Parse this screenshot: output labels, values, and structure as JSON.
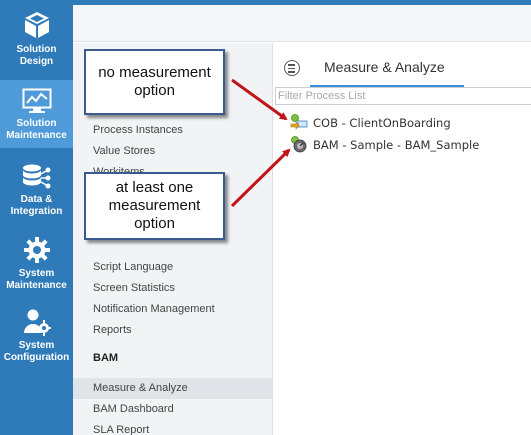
{
  "nav": {
    "items": [
      {
        "label": "Solution\nDesign",
        "icon": "cube-icon"
      },
      {
        "label": "Solution\nMaintenance",
        "icon": "monitor-chart-icon"
      },
      {
        "label": "Data &\nIntegration",
        "icon": "database-icon"
      },
      {
        "label": "System\nMaintenance",
        "icon": "gear-icon"
      },
      {
        "label": "System\nConfiguration",
        "icon": "user-gear-icon"
      }
    ],
    "active_index": 1
  },
  "menu": {
    "items_top": [
      "Process Instances",
      "Value Stores",
      "Workitems"
    ],
    "items_mid": [
      "Script Language",
      "Screen Statistics",
      "Notification Management",
      "Reports"
    ],
    "bam_heading": "BAM",
    "items_bam": [
      "Measure & Analyze",
      "BAM Dashboard",
      "SLA Report"
    ],
    "selected": "Measure & Analyze"
  },
  "main": {
    "tab_label": "Measure & Analyze",
    "filter_placeholder": "Filter Process List",
    "processes": [
      {
        "label": "COB - ClientOnBoarding",
        "icon": "process-flow-icon"
      },
      {
        "label": "BAM - Sample - BAM_Sample",
        "icon": "process-measure-icon"
      }
    ]
  },
  "callouts": {
    "first": "no measurement\noption",
    "second": "at least one\nmeasurement\noption"
  },
  "colors": {
    "nav_bg": "#2f7ab8",
    "nav_active": "#4f9ad8",
    "tab_underline": "#3a8dd6",
    "arrow": "#c0141c",
    "callout_border": "#3b5a8f"
  }
}
